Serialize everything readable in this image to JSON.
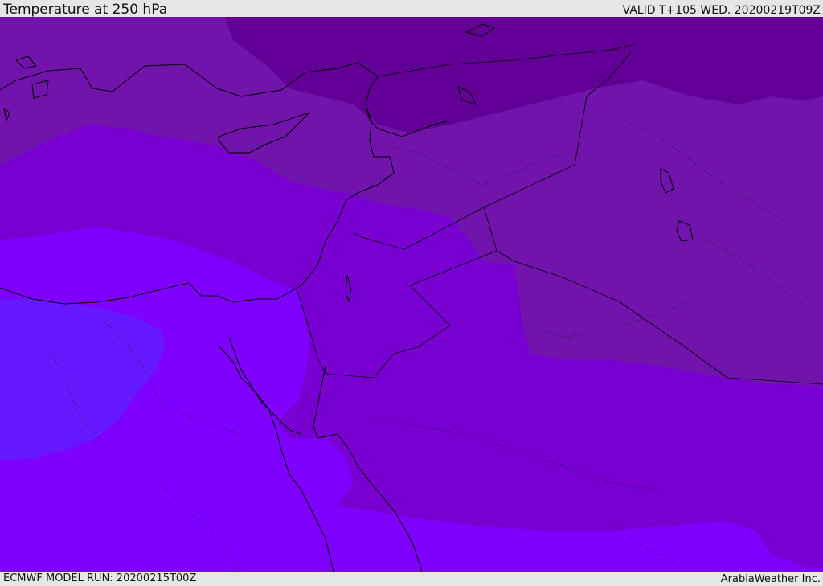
{
  "header": {
    "title": "Temperature at 250 hPa",
    "valid": "VALID T+105 WED. 20200219T09Z"
  },
  "footer": {
    "model_run": "ECMWF MODEL RUN: 20200215T00Z",
    "credit": "ArabiaWeather Inc."
  },
  "map": {
    "parameter": "temperature",
    "pressure_level": "250 hPa",
    "shading_colors": {
      "coldest": "#620096",
      "cold": "#7014ac",
      "cool": "#7800d0",
      "mild": "#7e00ff",
      "warm": "#6619ff"
    },
    "coastline_color": "#000000",
    "border_style": "dotted"
  }
}
